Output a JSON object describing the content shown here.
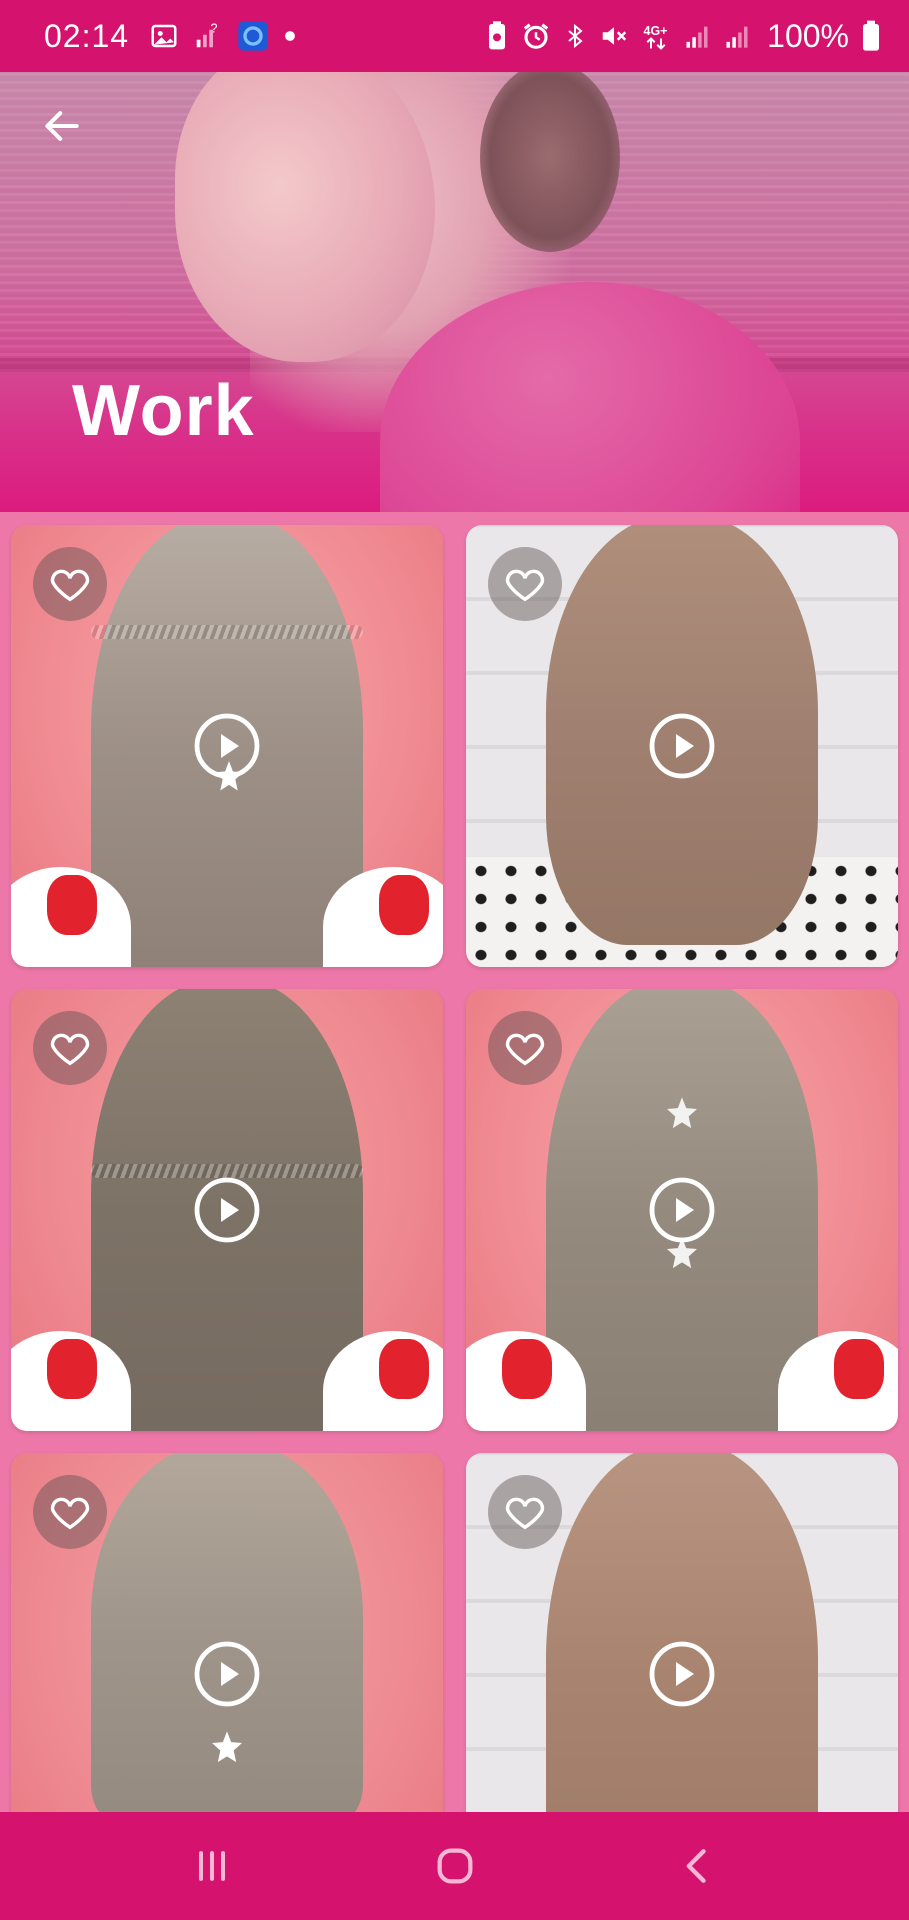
{
  "status_bar": {
    "time": "02:14",
    "battery": "100%",
    "left_icons": [
      "image-icon",
      "signal-question-icon",
      "app-badge-icon",
      "dot-icon"
    ],
    "right_icons": [
      "battery-saver-icon",
      "alarm-icon",
      "bluetooth-icon",
      "mute-icon",
      "4g-icon",
      "signal-icon",
      "signal-icon"
    ]
  },
  "header": {
    "title": "Work",
    "back_icon": "arrow-left-icon"
  },
  "grid": {
    "items": [
      {
        "style": "braided-crown-halfup",
        "favorite_icon": "heart-icon",
        "play_icon": "play-circle-icon"
      },
      {
        "style": "wrapped-low-ponytail",
        "favorite_icon": "heart-icon",
        "play_icon": "play-circle-icon"
      },
      {
        "style": "twisted-halfup",
        "favorite_icon": "heart-icon",
        "play_icon": "play-circle-icon"
      },
      {
        "style": "loop-bows-with-stars",
        "favorite_icon": "heart-icon",
        "play_icon": "play-circle-icon"
      },
      {
        "style": "tucked-low-bun",
        "favorite_icon": "heart-icon",
        "play_icon": "play-circle-icon"
      },
      {
        "style": "heart-knot-braids",
        "favorite_icon": "heart-icon",
        "play_icon": "play-circle-icon"
      }
    ]
  },
  "nav_bar": {
    "buttons": [
      "recent-apps-icon",
      "home-icon",
      "back-chevron-icon"
    ]
  },
  "colors": {
    "primary": "#d6126f",
    "background": "#ec77a8",
    "card_pink": "#f28a96",
    "card_wall": "#e6e4e6"
  }
}
